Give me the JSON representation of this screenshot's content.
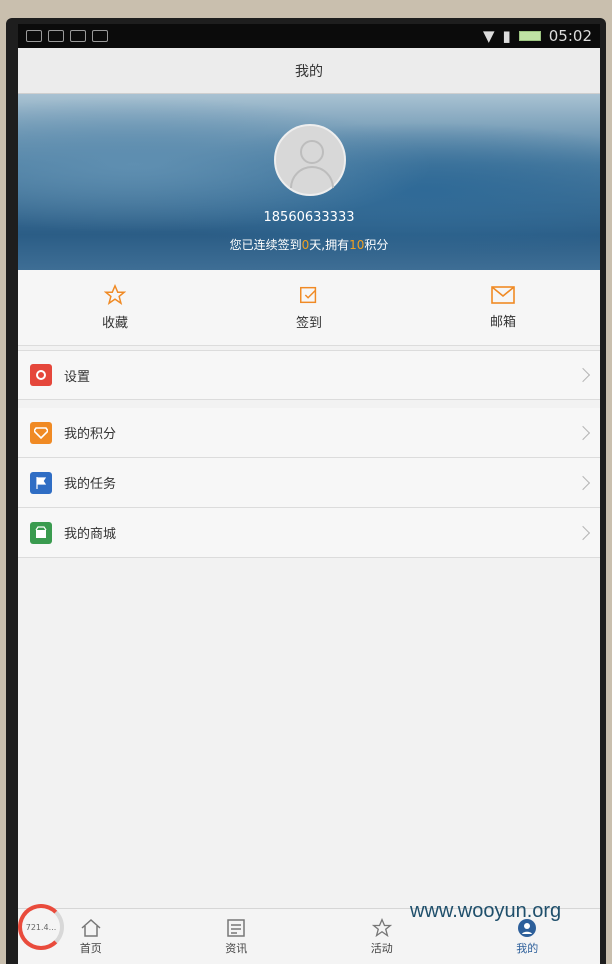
{
  "status_bar": {
    "time": "05:02"
  },
  "header": {
    "title": "我的"
  },
  "profile": {
    "phone": "18560633333",
    "signin_prefix": "您已连续签到",
    "days": "0",
    "signin_mid": "天,拥有",
    "points": "10",
    "signin_suffix": "积分"
  },
  "quick_actions": [
    {
      "label": "收藏",
      "icon": "star-icon"
    },
    {
      "label": "签到",
      "icon": "checkin-icon"
    },
    {
      "label": "邮箱",
      "icon": "mail-icon"
    }
  ],
  "menu": [
    {
      "label": "设置",
      "icon": "gear-icon",
      "color": "#e5473b"
    },
    {
      "label": "我的积分",
      "icon": "diamond-icon",
      "color": "#f08a24"
    },
    {
      "label": "我的任务",
      "icon": "flag-icon",
      "color": "#2f6dc4"
    },
    {
      "label": "我的商城",
      "icon": "store-icon",
      "color": "#3a9b4f"
    }
  ],
  "tab_bar": {
    "items": [
      {
        "label": "首页",
        "icon": "home-icon"
      },
      {
        "label": "资讯",
        "icon": "news-icon"
      },
      {
        "label": "活动",
        "icon": "activity-icon"
      },
      {
        "label": "我的",
        "icon": "user-icon",
        "active": true
      }
    ]
  },
  "gauge": {
    "label": "721.4..."
  },
  "watermark": {
    "text": "www.wooyun.org"
  },
  "colors": {
    "accent": "#f0a020",
    "active_tab": "#2d5f9a"
  }
}
